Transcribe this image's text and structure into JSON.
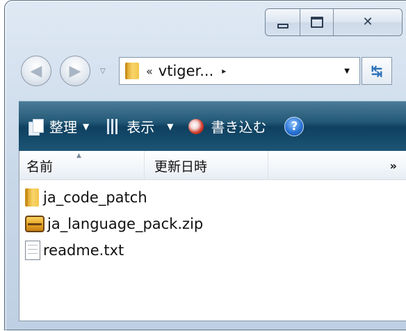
{
  "window": {
    "caption": {
      "minimize": "minimize",
      "maximize": "maximize",
      "close": "✕"
    }
  },
  "navigation": {
    "back_symbol": "◀",
    "forward_symbol": "▶",
    "address": {
      "chevron": "«",
      "path": "vtiger...",
      "arrow": "▸",
      "dropdown": "▼"
    },
    "refresh_symbol": "↹"
  },
  "commandbar": {
    "organize": "整理",
    "views": "表示",
    "burn": "書き込む",
    "help": "?"
  },
  "columns": {
    "name": "名前",
    "date_modified": "更新日時",
    "more": "»"
  },
  "files": [
    {
      "name": "ja_code_patch",
      "icon": "folder-icon"
    },
    {
      "name": "ja_language_pack.zip",
      "icon": "zip-archive-icon"
    },
    {
      "name": "readme.txt",
      "icon": "text-file-icon"
    }
  ],
  "colors": {
    "commandbar": "#245a78",
    "folder": "#f3c649",
    "frame": "#c8d7e8"
  }
}
